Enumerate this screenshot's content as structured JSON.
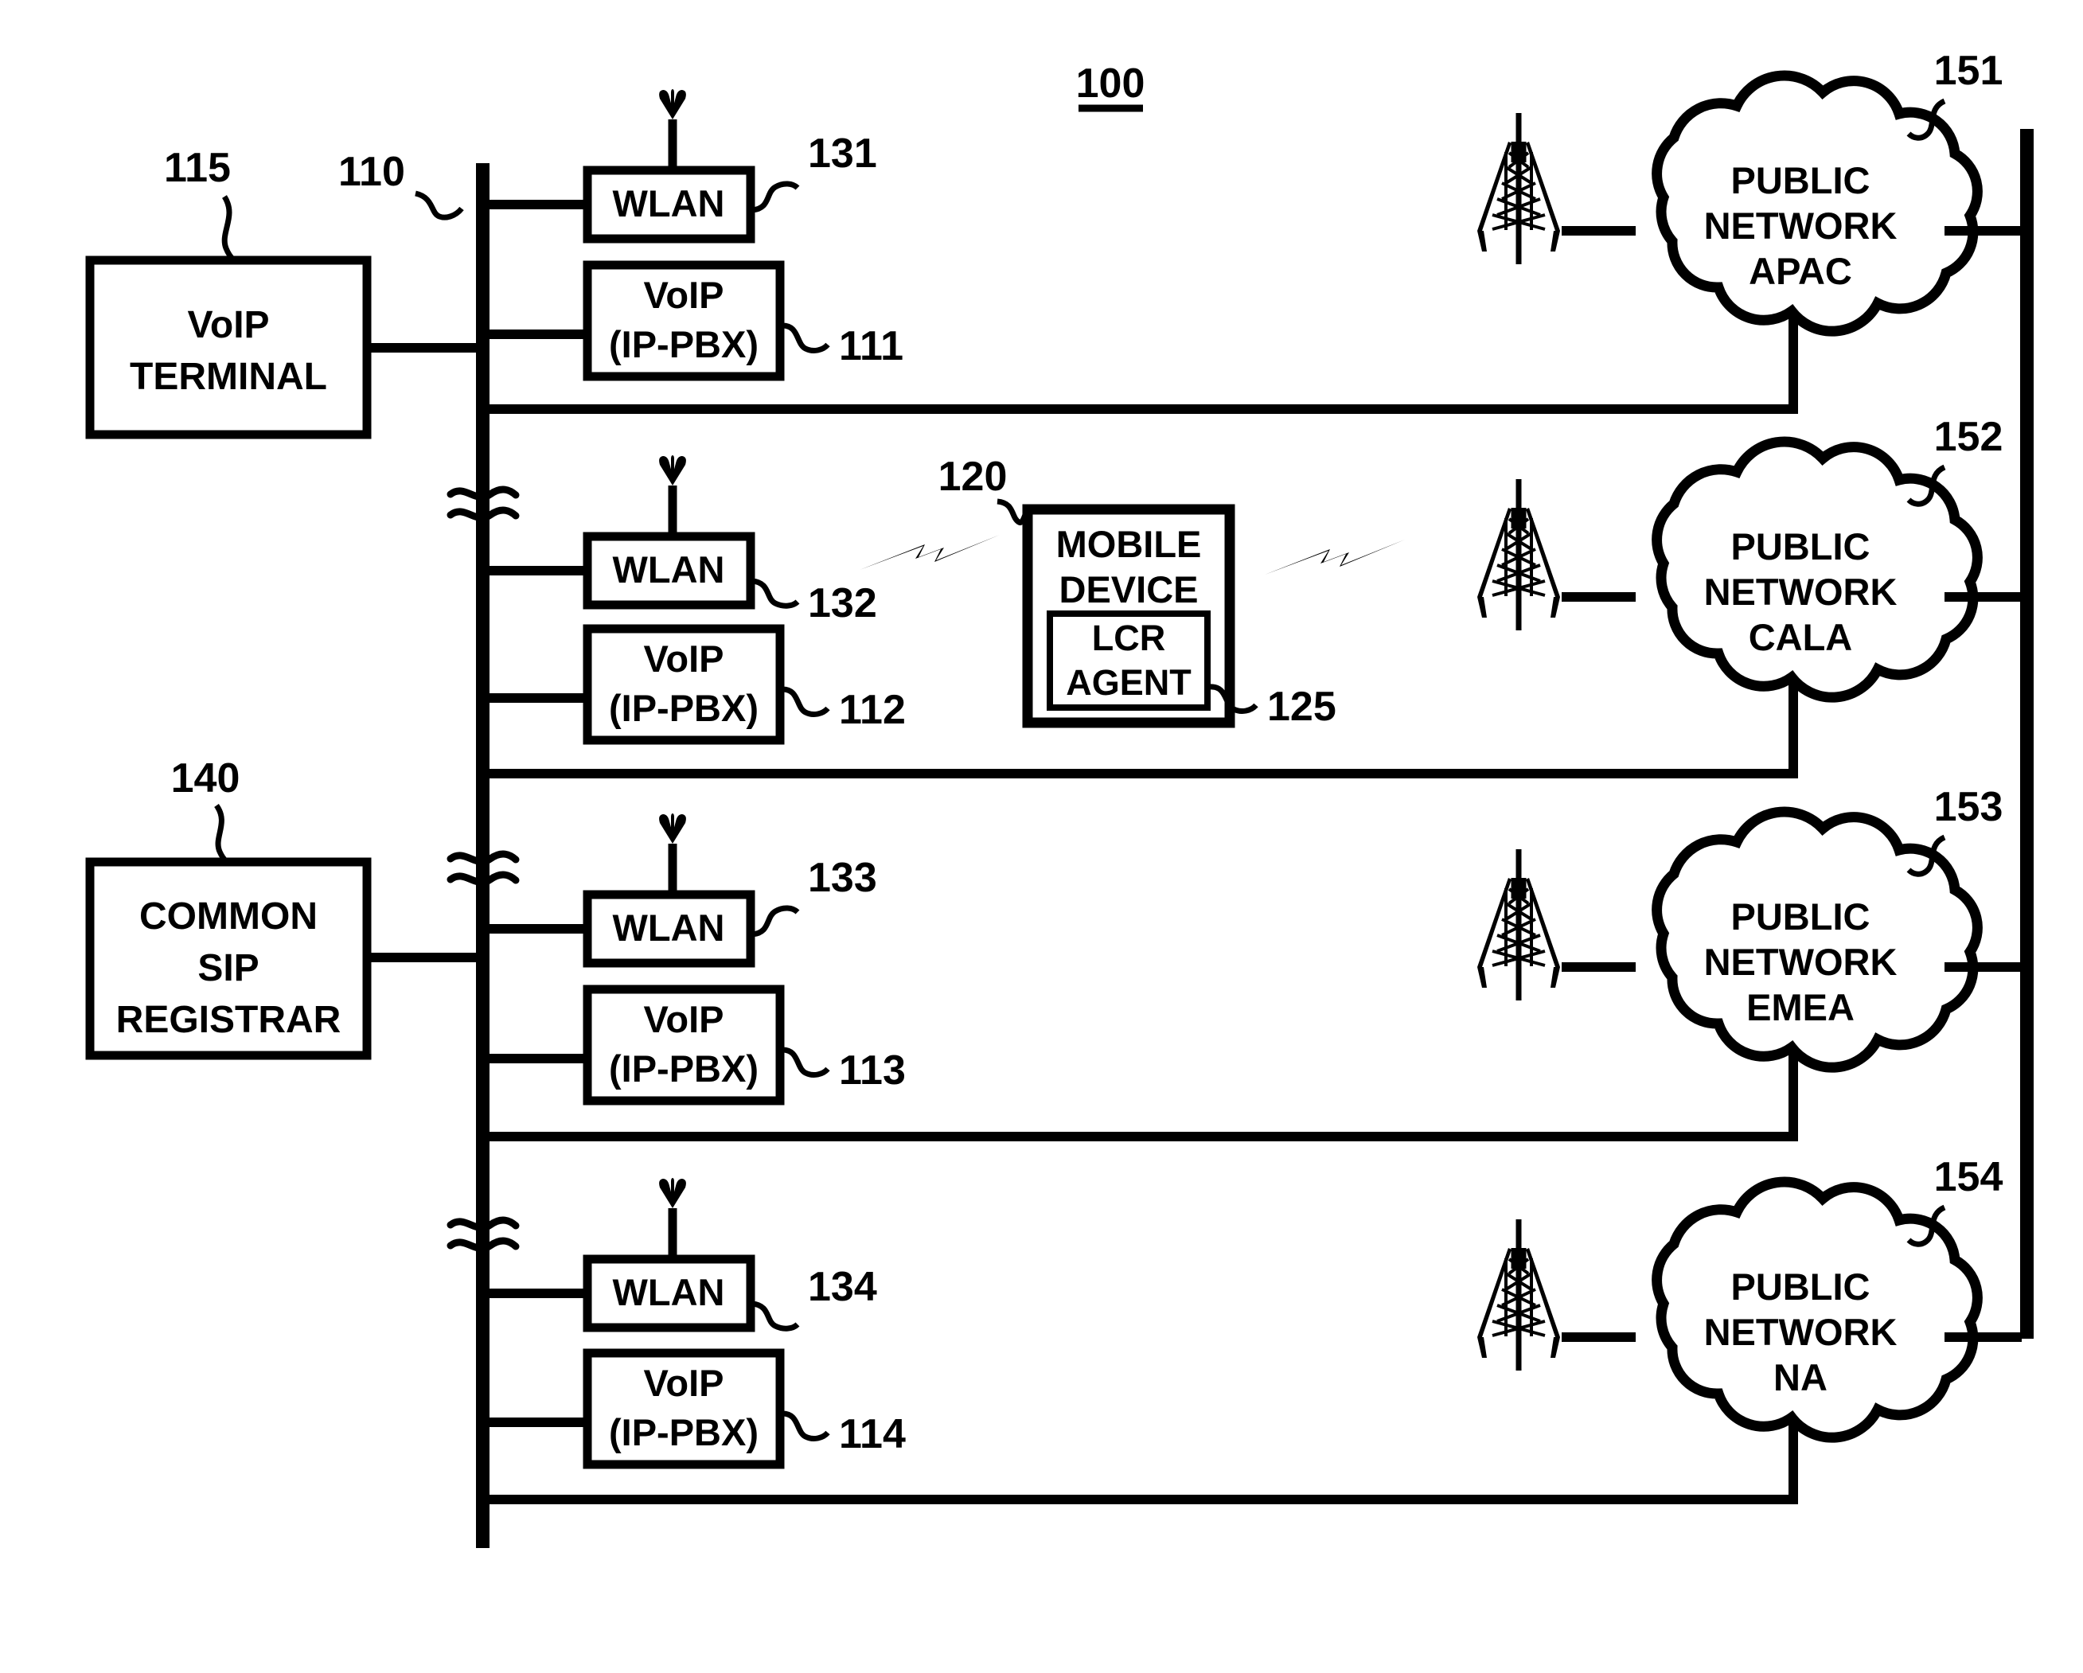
{
  "figure": {
    "number": "100",
    "kind": "patent-network-diagram"
  },
  "colors": {
    "stroke": "#000000",
    "background": "#ffffff",
    "text": "#000000"
  },
  "left_nodes": [
    {
      "id": "voip-terminal",
      "label_lines": [
        "VoIP",
        "TERMINAL"
      ],
      "ref": "115"
    },
    {
      "id": "common-sip-registrar",
      "label_lines": [
        "COMMON",
        "SIP",
        "REGISTRAR"
      ],
      "ref": "140"
    }
  ],
  "bus": {
    "ref": "110",
    "break_marks": 3
  },
  "sites": [
    {
      "wlan": {
        "label": "WLAN",
        "ref": "131"
      },
      "voip": {
        "label_lines": [
          "VoIP",
          "(IP-PBX)"
        ],
        "ref": "111"
      }
    },
    {
      "wlan": {
        "label": "WLAN",
        "ref": "132"
      },
      "voip": {
        "label_lines": [
          "VoIP",
          "(IP-PBX)"
        ],
        "ref": "112"
      }
    },
    {
      "wlan": {
        "label": "WLAN",
        "ref": "133"
      },
      "voip": {
        "label_lines": [
          "VoIP",
          "(IP-PBX)"
        ],
        "ref": "113"
      }
    },
    {
      "wlan": {
        "label": "WLAN",
        "ref": "134"
      },
      "voip": {
        "label_lines": [
          "VoIP",
          "(IP-PBX)"
        ],
        "ref": "114"
      }
    }
  ],
  "mobile_device": {
    "label_lines": [
      "MOBILE",
      "DEVICE"
    ],
    "ref": "120",
    "agent": {
      "label_lines": [
        "LCR",
        "AGENT"
      ],
      "ref": "125"
    }
  },
  "networks": [
    {
      "label_lines": [
        "PUBLIC",
        "NETWORK",
        "APAC"
      ],
      "ref": "151"
    },
    {
      "label_lines": [
        "PUBLIC",
        "NETWORK",
        "CALA"
      ],
      "ref": "152"
    },
    {
      "label_lines": [
        "PUBLIC",
        "NETWORK",
        "EMEA"
      ],
      "ref": "153"
    },
    {
      "label_lines": [
        "PUBLIC",
        "NETWORK",
        "NA"
      ],
      "ref": "154"
    }
  ],
  "icons": {
    "antenna": "antenna-icon",
    "cell_tower": "cell-tower-icon",
    "lightning": "lightning-bolt-icon",
    "break": "bus-break-icon"
  }
}
